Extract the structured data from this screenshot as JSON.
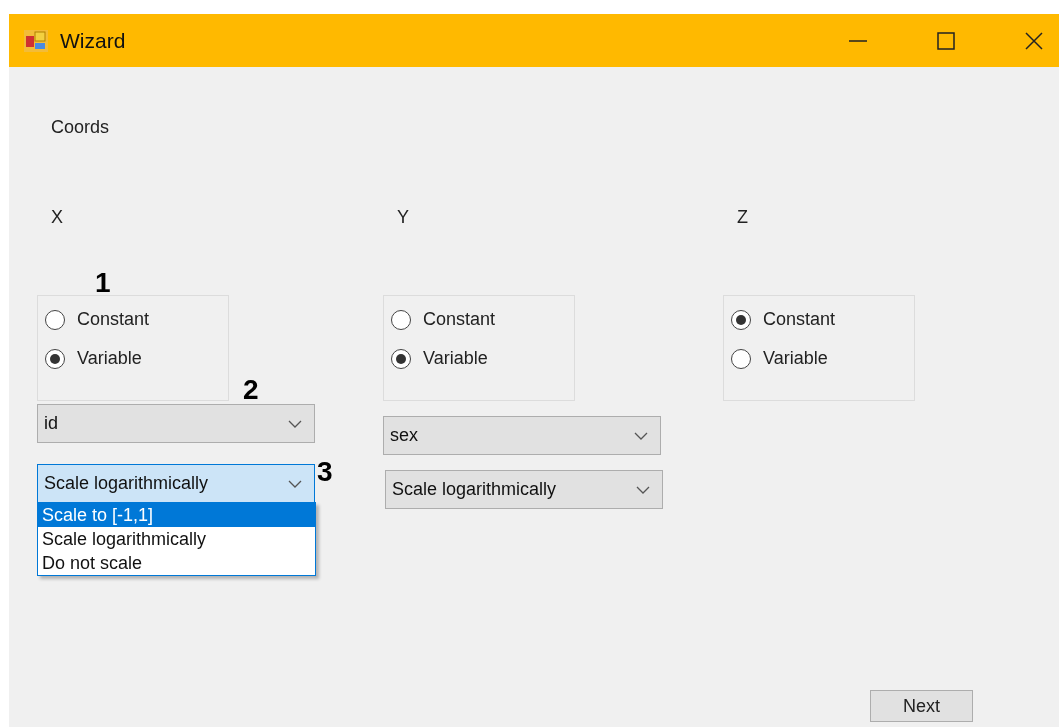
{
  "window": {
    "title": "Wizard"
  },
  "section_label": "Coords",
  "axes": [
    {
      "label": "X",
      "options": [
        {
          "label": "Constant",
          "selected": false
        },
        {
          "label": "Variable",
          "selected": true
        }
      ],
      "variable": "id",
      "scaling": {
        "value": "Scale logarithmically",
        "open": true,
        "items": [
          {
            "label": "Scale to [-1,1]",
            "highlighted": true
          },
          {
            "label": "Scale logarithmically",
            "highlighted": false
          },
          {
            "label": "Do not scale",
            "highlighted": false
          }
        ]
      }
    },
    {
      "label": "Y",
      "options": [
        {
          "label": "Constant",
          "selected": false
        },
        {
          "label": "Variable",
          "selected": true
        }
      ],
      "variable": "sex",
      "scaling": {
        "value": "Scale logarithmically",
        "open": false
      }
    },
    {
      "label": "Z",
      "options": [
        {
          "label": "Constant",
          "selected": true
        },
        {
          "label": "Variable",
          "selected": false
        }
      ]
    }
  ],
  "annotations": [
    "1",
    "2",
    "3"
  ],
  "buttons": [
    {
      "label": "Next"
    }
  ]
}
